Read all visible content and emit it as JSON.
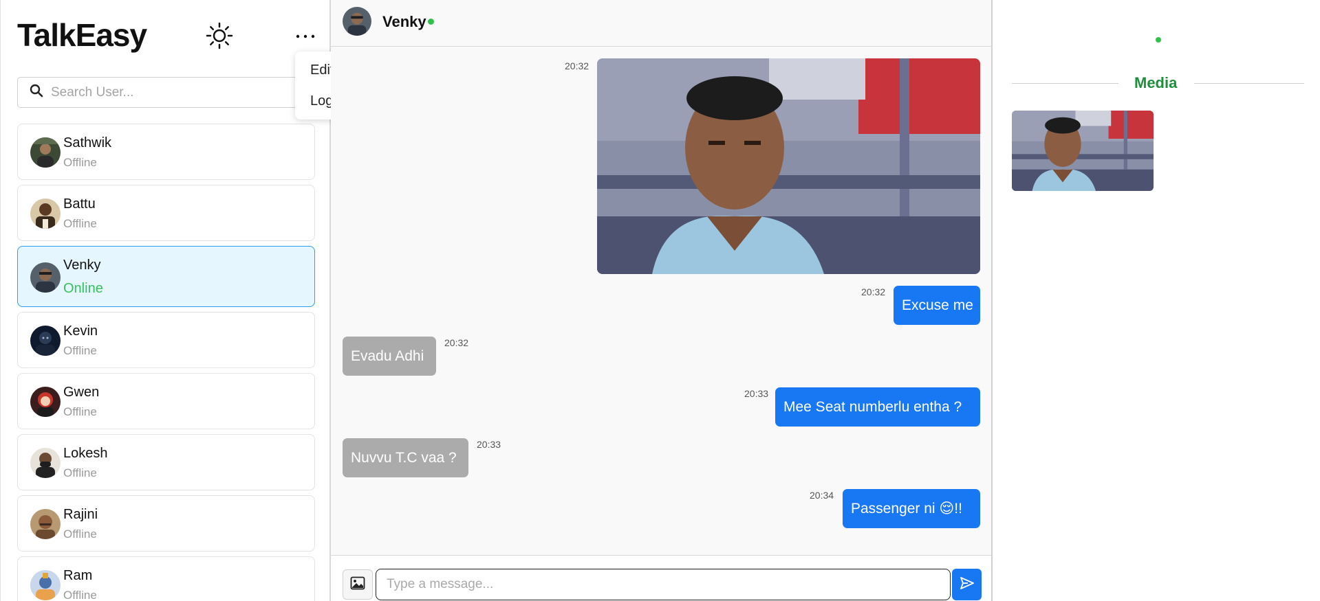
{
  "app": {
    "brand": "TalkEasy"
  },
  "search": {
    "placeholder": "Search User..."
  },
  "menu": {
    "items": [
      "Edit Profile",
      "Logout"
    ]
  },
  "users": [
    {
      "name": "Sathwik",
      "status": "Offline"
    },
    {
      "name": "Battu",
      "status": "Offline"
    },
    {
      "name": "Venky",
      "status": "Online"
    },
    {
      "name": "Kevin",
      "status": "Offline"
    },
    {
      "name": "Gwen",
      "status": "Offline"
    },
    {
      "name": "Lokesh",
      "status": "Offline"
    },
    {
      "name": "Rajini",
      "status": "Offline"
    },
    {
      "name": "Ram",
      "status": "Offline"
    }
  ],
  "chat": {
    "contact_name": "Venky",
    "messages": [
      {
        "type": "image",
        "time": "20:32"
      },
      {
        "type": "sent",
        "text": "Excuse me",
        "time": "20:32"
      },
      {
        "type": "received",
        "text": "Evadu Adhi",
        "time": "20:32"
      },
      {
        "type": "sent",
        "text": "Mee Seat numberlu entha ?",
        "time": "20:33"
      },
      {
        "type": "received",
        "text": "Nuvvu T.C vaa ?",
        "time": "20:33"
      },
      {
        "type": "sent",
        "text": "Passenger ni 😌!!",
        "time": "20:34"
      }
    ],
    "composer_placeholder": "Type a message..."
  },
  "media_panel": {
    "title": "Media"
  },
  "colors": {
    "sent_bubble": "#1877f2",
    "received_bubble": "#ababab",
    "online": "#2ec24a",
    "media_title": "#1e8f3a",
    "active_row": "#e6f6ff"
  },
  "icons": [
    "search-icon",
    "sun-icon",
    "more-icon",
    "image-icon",
    "send-icon"
  ]
}
